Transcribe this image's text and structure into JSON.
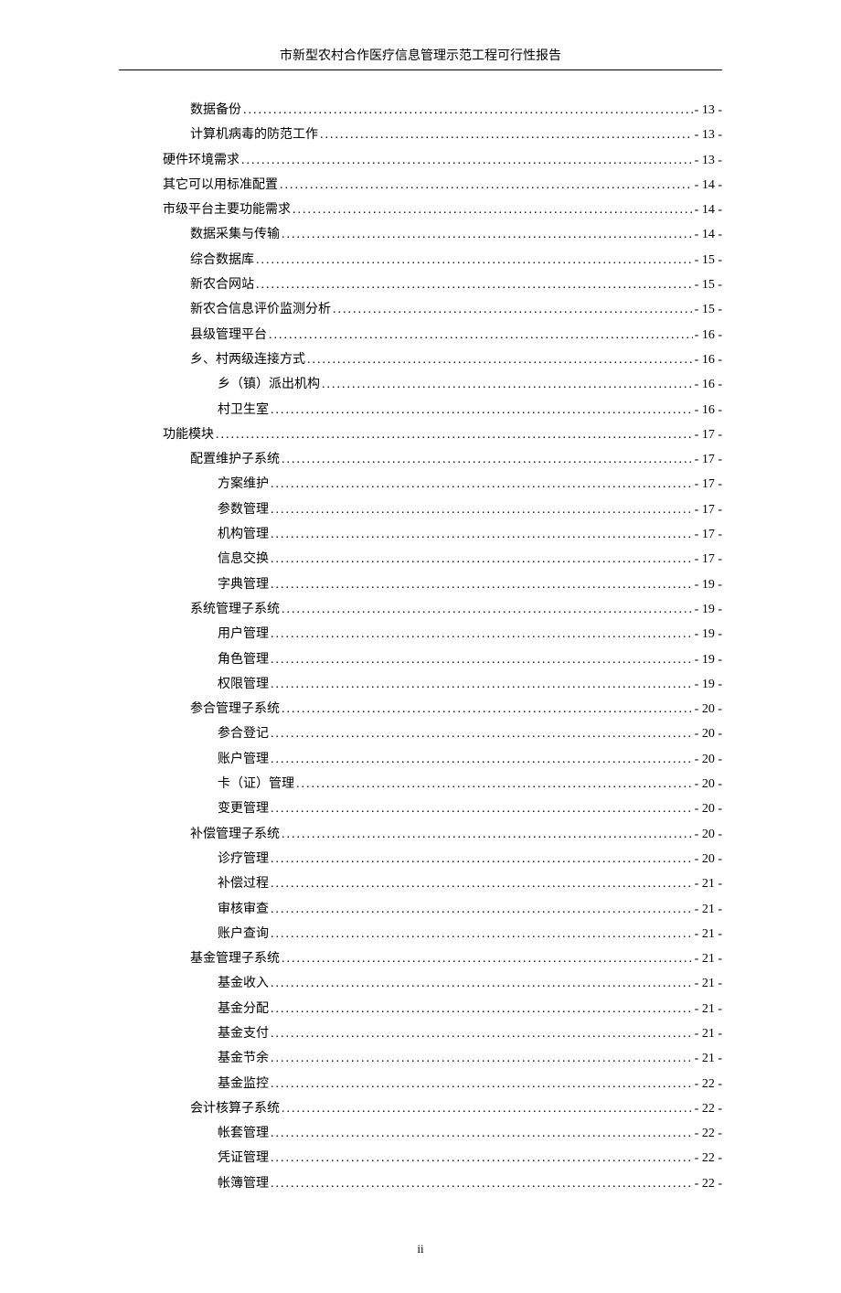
{
  "header": {
    "title": "市新型农村合作医疗信息管理示范工程可行性报告"
  },
  "toc": [
    {
      "label": "数据备份",
      "page": "- 13 -",
      "indent": 2
    },
    {
      "label": "计算机病毒的防范工作",
      "page": "- 13 -",
      "indent": 2
    },
    {
      "label": "硬件环境需求",
      "page": "- 13 -",
      "indent": 1
    },
    {
      "label": "其它可以用标准配置",
      "page": "- 14 -",
      "indent": 1
    },
    {
      "label": "市级平台主要功能需求",
      "page": "- 14 -",
      "indent": 1
    },
    {
      "label": "数据采集与传输",
      "page": "- 14 -",
      "indent": 2
    },
    {
      "label": "综合数据库",
      "page": "- 15 -",
      "indent": 2
    },
    {
      "label": "新农合网站",
      "page": "- 15 -",
      "indent": 2
    },
    {
      "label": "新农合信息评价监测分析",
      "page": "- 15 -",
      "indent": 2
    },
    {
      "label": "县级管理平台",
      "page": "- 16 -",
      "indent": 2
    },
    {
      "label": "乡、村两级连接方式",
      "page": "- 16 -",
      "indent": 2
    },
    {
      "label": "乡（镇）派出机构",
      "page": "- 16 -",
      "indent": 3
    },
    {
      "label": "村卫生室",
      "page": "- 16 -",
      "indent": 3
    },
    {
      "label": "功能模块",
      "page": "- 17 -",
      "indent": 1
    },
    {
      "label": "配置维护子系统",
      "page": "- 17 -",
      "indent": 2
    },
    {
      "label": "方案维护",
      "page": "- 17 -",
      "indent": 3
    },
    {
      "label": "参数管理",
      "page": "- 17 -",
      "indent": 3
    },
    {
      "label": "机构管理",
      "page": "- 17 -",
      "indent": 3
    },
    {
      "label": "信息交换",
      "page": "- 17 -",
      "indent": 3
    },
    {
      "label": "字典管理",
      "page": "- 19 -",
      "indent": 3
    },
    {
      "label": "系统管理子系统",
      "page": "- 19 -",
      "indent": 2
    },
    {
      "label": "用户管理",
      "page": "- 19 -",
      "indent": 3
    },
    {
      "label": "角色管理",
      "page": "- 19 -",
      "indent": 3
    },
    {
      "label": "权限管理",
      "page": "- 19 -",
      "indent": 3
    },
    {
      "label": "参合管理子系统",
      "page": "- 20 -",
      "indent": 2
    },
    {
      "label": "参合登记",
      "page": "- 20 -",
      "indent": 3
    },
    {
      "label": "账户管理",
      "page": "- 20 -",
      "indent": 3
    },
    {
      "label": "卡（证）管理",
      "page": "- 20 -",
      "indent": 3
    },
    {
      "label": "变更管理",
      "page": "- 20 -",
      "indent": 3
    },
    {
      "label": "补偿管理子系统",
      "page": "- 20 -",
      "indent": 2
    },
    {
      "label": "诊疗管理",
      "page": "- 20 -",
      "indent": 3
    },
    {
      "label": "补偿过程",
      "page": "- 21 -",
      "indent": 3
    },
    {
      "label": "审核审查",
      "page": "- 21 -",
      "indent": 3
    },
    {
      "label": "账户查询",
      "page": "- 21 -",
      "indent": 3
    },
    {
      "label": "基金管理子系统",
      "page": "- 21 -",
      "indent": 2
    },
    {
      "label": "基金收入",
      "page": "- 21 -",
      "indent": 3
    },
    {
      "label": "基金分配",
      "page": "- 21 -",
      "indent": 3
    },
    {
      "label": "基金支付",
      "page": "- 21 -",
      "indent": 3
    },
    {
      "label": "基金节余",
      "page": "- 21 -",
      "indent": 3
    },
    {
      "label": "基金监控",
      "page": "- 22 -",
      "indent": 3
    },
    {
      "label": "会计核算子系统",
      "page": "- 22 -",
      "indent": 2
    },
    {
      "label": "帐套管理",
      "page": "- 22 -",
      "indent": 3
    },
    {
      "label": "凭证管理",
      "page": "- 22 -",
      "indent": 3
    },
    {
      "label": "帐簿管理",
      "page": "- 22 -",
      "indent": 3
    }
  ],
  "footer": {
    "page_number": "ii"
  }
}
